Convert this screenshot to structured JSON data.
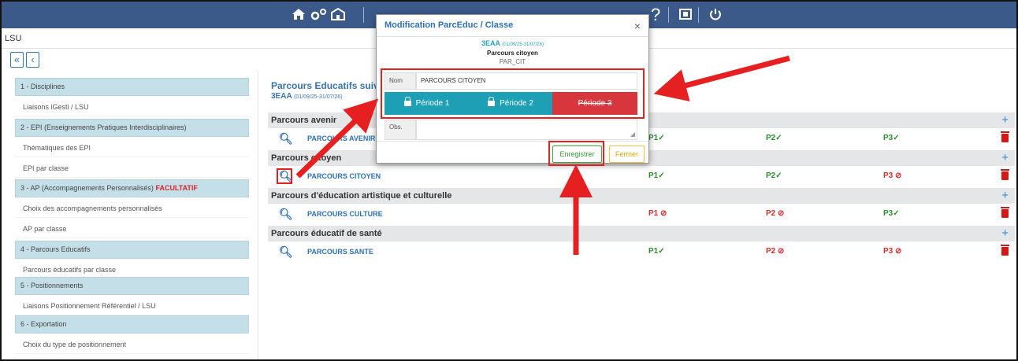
{
  "app": {
    "breadcrumb": "LSU",
    "nav_first": "«",
    "nav_prev": "‹"
  },
  "sidebar": {
    "items": [
      {
        "label": "1 - Disciplines",
        "type": "section"
      },
      {
        "label": "Liaisons iGesti / LSU",
        "type": "item"
      },
      {
        "label": "2 - EPI (Enseignements Pratiques Interdisciplinaires)",
        "type": "section"
      },
      {
        "label": "Thématiques des EPI",
        "type": "item"
      },
      {
        "label": "EPI par classe",
        "type": "item"
      },
      {
        "label": "3 - AP (Accompagnements Personnalisés)",
        "type": "section",
        "badge": "FACULTATIF"
      },
      {
        "label": "Choix des accompagnements personnalisés",
        "type": "item"
      },
      {
        "label": "AP par classe",
        "type": "item"
      },
      {
        "label": "4 - Parcours Educatifs",
        "type": "section"
      },
      {
        "label": "Parcours éducatifs par classe",
        "type": "item"
      },
      {
        "label": "5 - Positionnements",
        "type": "section"
      },
      {
        "label": "Liaisons Positionnement Référentiel / LSU",
        "type": "item"
      },
      {
        "label": "6 - Exportation",
        "type": "section"
      },
      {
        "label": "Choix du type de positionnement",
        "type": "item"
      }
    ]
  },
  "main": {
    "title": "Parcours Educatifs suivis ,",
    "class_code": "3EAA",
    "class_dates": "(01/09/25-31/07/26)",
    "categories": [
      {
        "name": "Parcours avenir",
        "parcours": "PARCOURS AVENIR",
        "p1": "P1",
        "p1_ok": true,
        "p2": "P2",
        "p2_ok": true,
        "p3": "P3",
        "p3_ok": true
      },
      {
        "name": "Parcours citoyen",
        "parcours": "PARCOURS CITOYEN",
        "p1": "P1",
        "p1_ok": true,
        "p2": "P2",
        "p2_ok": true,
        "p3": "P3",
        "p3_ok": false
      },
      {
        "name": "Parcours d'éducation artistique et culturelle",
        "parcours": "PARCOURS CULTURE",
        "p1": "P1",
        "p1_ok": false,
        "p2": "P2",
        "p2_ok": false,
        "p3": "P3",
        "p3_ok": true
      },
      {
        "name": "Parcours éducatif de santé",
        "parcours": "PARCOURS SANTE",
        "p1": "P1",
        "p1_ok": true,
        "p2": "P2",
        "p2_ok": false,
        "p3": "P3",
        "p3_ok": false
      }
    ],
    "check_symbol": "✓",
    "forbidden_symbol": "⃠",
    "plus_symbol": "+"
  },
  "modal": {
    "title": "Modification ParcEduc / Classe",
    "close_symbol": "×",
    "class_code": "3EAA",
    "class_dates": "(01/09/25-31/07/26)",
    "parcours_name": "Parcours citoyen",
    "parcours_code": "PAR_CIT",
    "nom_label": "Nom",
    "nom_value": "PARCOURS CITOYEN",
    "periode1": "Période 1",
    "periode2": "Période 2",
    "periode3": "Période 3",
    "obs_label": "Obs.",
    "save_label": "Enregistrer",
    "close_label": "Fermer"
  },
  "colors": {
    "topbar": "#3b5a8a",
    "period_active": "#1d9fb6",
    "period_disabled": "#d6363c",
    "annotation": "#e62020"
  }
}
